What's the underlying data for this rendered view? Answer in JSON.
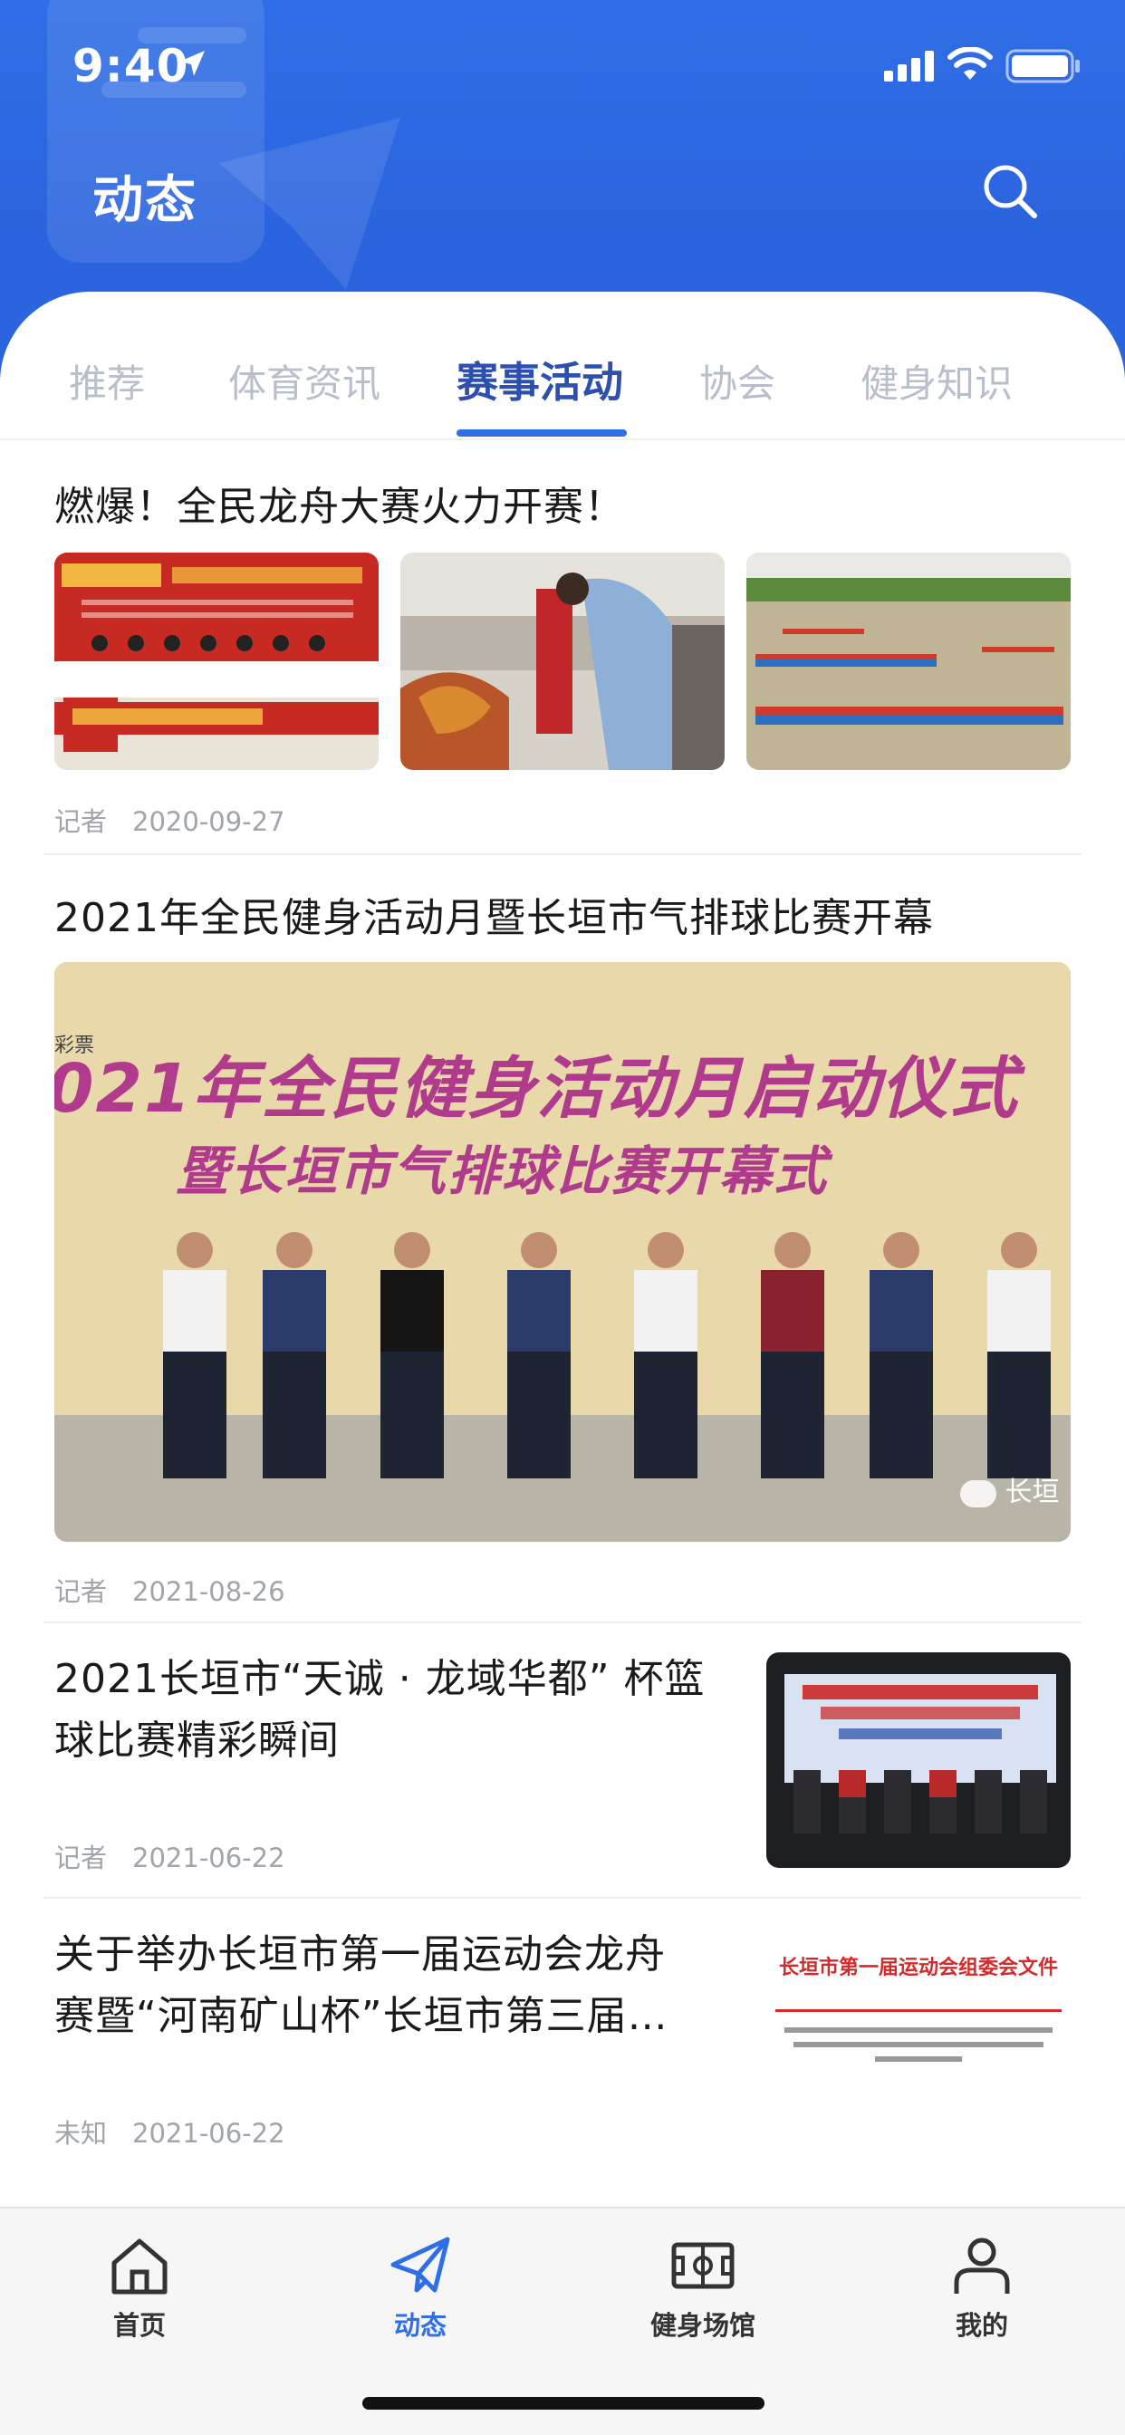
{
  "status_bar": {
    "time": "9:40"
  },
  "header": {
    "title": "动态",
    "search_icon": "search-icon"
  },
  "tabs": [
    {
      "label": "推荐",
      "active": false
    },
    {
      "label": "体育资讯",
      "active": false
    },
    {
      "label": "赛事活动",
      "active": true
    },
    {
      "label": "协会",
      "active": false
    },
    {
      "label": "健身知识",
      "active": false
    }
  ],
  "articles": [
    {
      "title": "燃爆！全民龙舟大赛火力开赛！",
      "author": "记者",
      "date": "2020-09-27",
      "layout": "three-images"
    },
    {
      "title": "2021年全民健身活动月暨长垣市气排球比赛开幕",
      "author": "记者",
      "date": "2021-08-26",
      "layout": "large-image",
      "image_banner_line1": "021年全民健身活动月启动仪式",
      "image_banner_line2": "暨长垣市气排球比赛开幕式",
      "image_tag": "彩票",
      "image_watermark": "长垣"
    },
    {
      "title_line1": "2021长垣市“天诚 · 龙域华都” 杯篮",
      "title_line2": "球比赛精彩瞬间",
      "author": "记者",
      "date": "2021-06-22",
      "layout": "right-image"
    },
    {
      "title_line1": "关于举办长垣市第一届运动会龙舟",
      "title_line2": "赛暨“河南矿山杯”长垣市第三届…",
      "author": "未知",
      "date": "2021-06-22",
      "layout": "right-image",
      "image_doc_title": "长垣市第一届运动会组委会文件"
    }
  ],
  "tabbar": [
    {
      "label": "首页",
      "icon": "home-icon",
      "active": false
    },
    {
      "label": "动态",
      "icon": "paper-plane-icon",
      "active": true
    },
    {
      "label": "健身场馆",
      "icon": "stadium-icon",
      "active": false
    },
    {
      "label": "我的",
      "icon": "user-icon",
      "active": false
    }
  ],
  "colors": {
    "brand_blue": "#2f6ee6",
    "active_tab": "#2c4fb0",
    "inactive_tab": "#b8bfcc"
  }
}
